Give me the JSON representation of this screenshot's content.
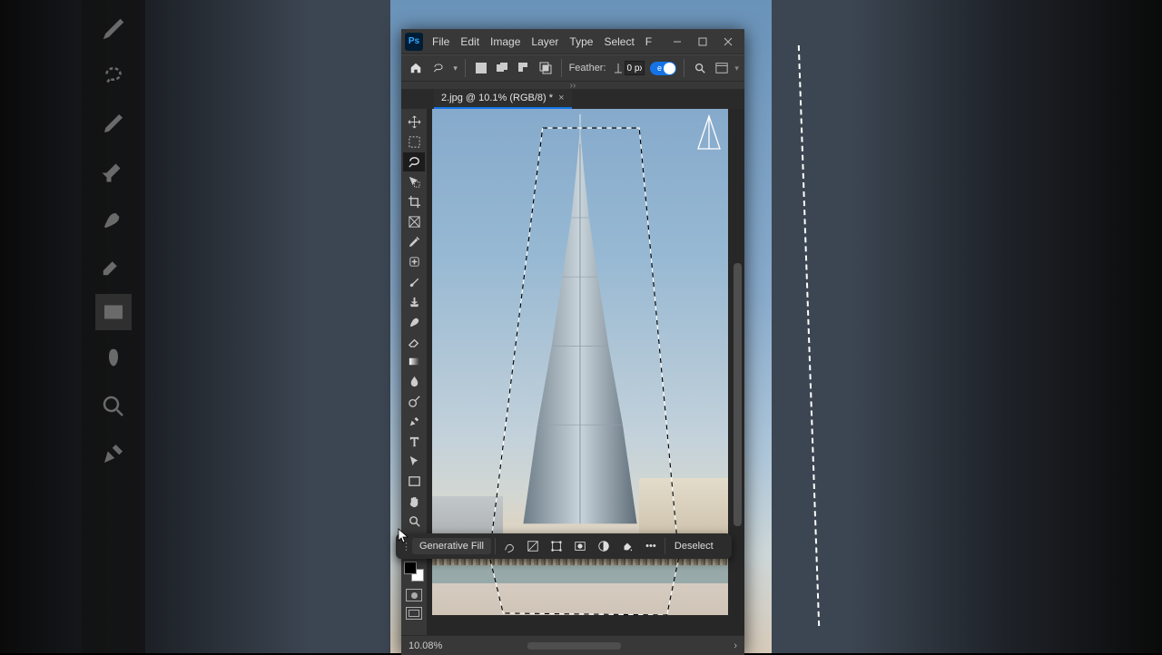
{
  "menu": {
    "file": "File",
    "edit": "Edit",
    "image": "Image",
    "layer": "Layer",
    "type": "Type",
    "select": "Select",
    "filter_short": "F"
  },
  "ps_badge": "Ps",
  "options": {
    "feather_label": "Feather:",
    "feather_value": "0 px",
    "aa_hint": "e"
  },
  "document_tab": "2.jpg @ 10.1% (RGB/8) *",
  "status": {
    "zoom": "10.08%"
  },
  "ctx": {
    "gen_fill": "Generative Fill",
    "deselect": "Deselect",
    "more": "•••"
  },
  "icons": {
    "home": "home",
    "lasso": "lasso-icon",
    "chev_down": "▾",
    "minimize": "–",
    "maximize": "□",
    "close": "×",
    "tab_close": "×"
  },
  "tools": [
    "move-tool",
    "marquee-tool",
    "lasso-tool",
    "object-select-tool",
    "crop-tool",
    "frame-tool",
    "eyedropper-tool",
    "healing-brush-tool",
    "brush-tool",
    "clone-stamp-tool",
    "history-brush-tool",
    "eraser-tool",
    "gradient-tool",
    "blur-tool",
    "dodge-tool",
    "pen-tool",
    "type-tool",
    "path-select-tool",
    "rectangle-tool",
    "hand-tool",
    "zoom-tool",
    "more-tools"
  ],
  "bg_left_tools": [
    "eyedropper-icon",
    "spot-heal-icon",
    "brush-icon",
    "clone-stamp-icon",
    "history-brush-icon",
    "eraser-icon",
    "gradient-icon",
    "blur-icon",
    "zoom-icon",
    "pen-icon"
  ],
  "ctx_icons": [
    "select-subject-icon",
    "remove-bg-icon",
    "transform-icon",
    "mask-icon",
    "adjust-icon",
    "fill-icon"
  ]
}
